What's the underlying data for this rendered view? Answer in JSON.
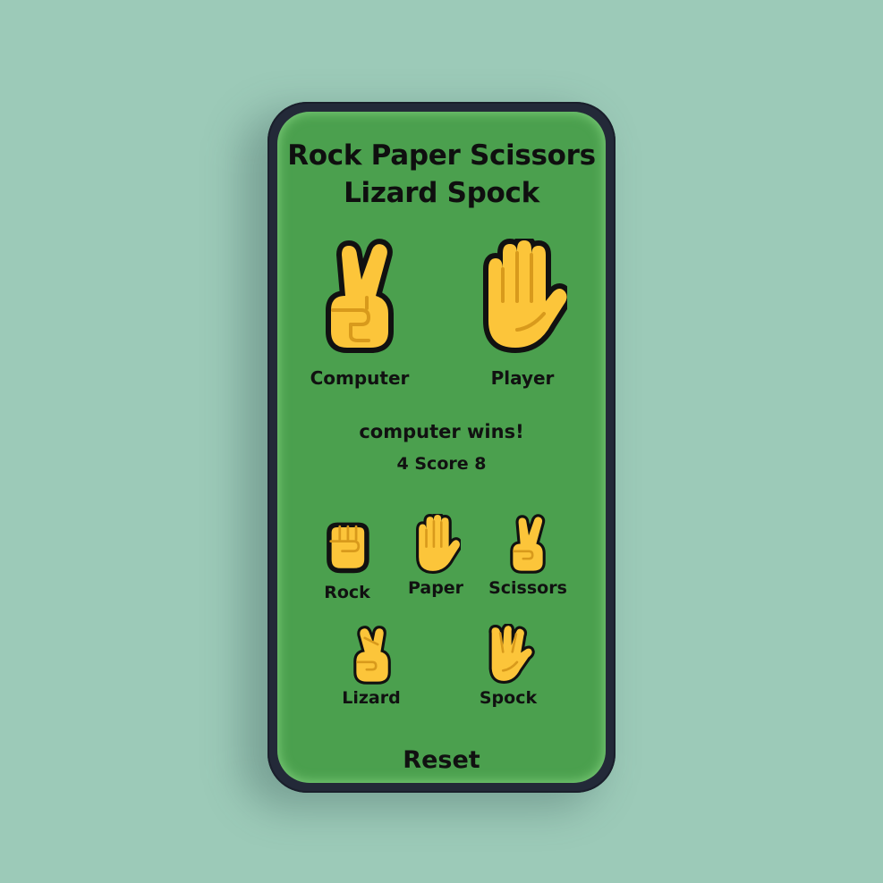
{
  "app": {
    "title_line1": "Rock Paper Scissors",
    "title_line2": "Lizard Spock"
  },
  "players": {
    "computer": {
      "label": "Computer",
      "choice_icon": "victory-hand-icon"
    },
    "player": {
      "label": "Player",
      "choice_icon": "raised-hand-icon"
    }
  },
  "status": {
    "result": "computer wins!",
    "score": "4 Score 8"
  },
  "choices": [
    {
      "label": "Rock",
      "icon": "fist-icon"
    },
    {
      "label": "Paper",
      "icon": "raised-hand-icon"
    },
    {
      "label": "Scissors",
      "icon": "victory-hand-icon"
    },
    {
      "label": "Lizard",
      "icon": "crossed-fingers-icon"
    },
    {
      "label": "Spock",
      "icon": "vulcan-salute-icon"
    }
  ],
  "controls": {
    "reset_label": "Reset"
  },
  "colors": {
    "background": "#9ccab8",
    "screen": "#4ba04e",
    "phone_frame": "#232938",
    "hand_fill": "#fcc53a",
    "hand_line": "#d89a1c"
  }
}
